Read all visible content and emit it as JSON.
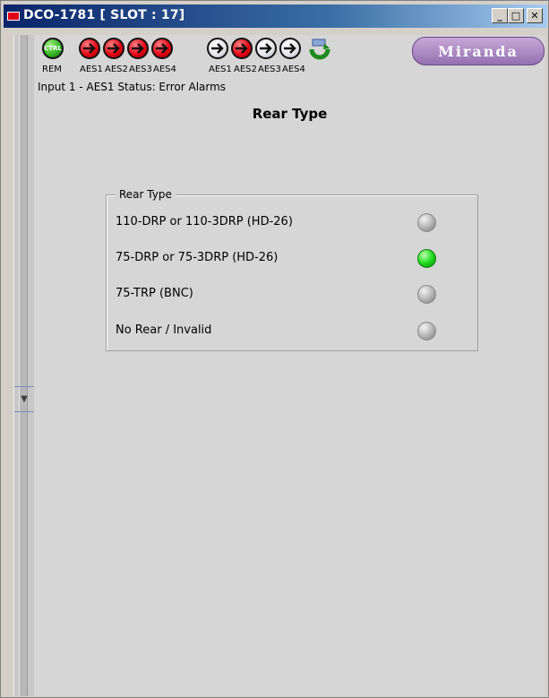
{
  "window": {
    "title": "DCO-1781 [ SLOT : 17]",
    "controls": {
      "minimize": "_",
      "maximize": "□",
      "close": "✕"
    }
  },
  "iconbar": {
    "ctrl_icon_text": "CTRL",
    "labels": [
      "REM",
      "AES1",
      "AES2",
      "AES3",
      "AES4",
      "AES1",
      "AES2",
      "AES3",
      "AES4"
    ],
    "icons": [
      {
        "name": "ctrl-icon",
        "color": "green"
      },
      {
        "name": "aes1-input-error-icon",
        "color": "red"
      },
      {
        "name": "aes2-input-error-icon",
        "color": "red"
      },
      {
        "name": "aes3-input-error-icon",
        "color": "red"
      },
      {
        "name": "aes4-input-error-icon",
        "color": "red"
      },
      {
        "name": "aes1-output-icon",
        "color": "white"
      },
      {
        "name": "aes2-output-error-icon",
        "color": "red"
      },
      {
        "name": "aes3-output-icon",
        "color": "white"
      },
      {
        "name": "aes4-output-icon",
        "color": "white"
      }
    ],
    "logo_text": "Miranda"
  },
  "status": {
    "text": "Input 1 - AES1 Status: Error Alarms"
  },
  "page": {
    "heading": "Rear Type"
  },
  "rear_type_group": {
    "title": "Rear Type",
    "rows": [
      {
        "label": "110-DRP or 110-3DRP (HD-26)",
        "active": false
      },
      {
        "label": "75-DRP or 75-3DRP (HD-26)",
        "active": true
      },
      {
        "label": "75-TRP (BNC)",
        "active": false
      },
      {
        "label": "No Rear / Invalid",
        "active": false
      }
    ]
  },
  "colors": {
    "led_on": "#1edc1e",
    "led_off": "#b0b0b0",
    "alarm_red": "#e00010",
    "titlebar": "#0a246a"
  }
}
